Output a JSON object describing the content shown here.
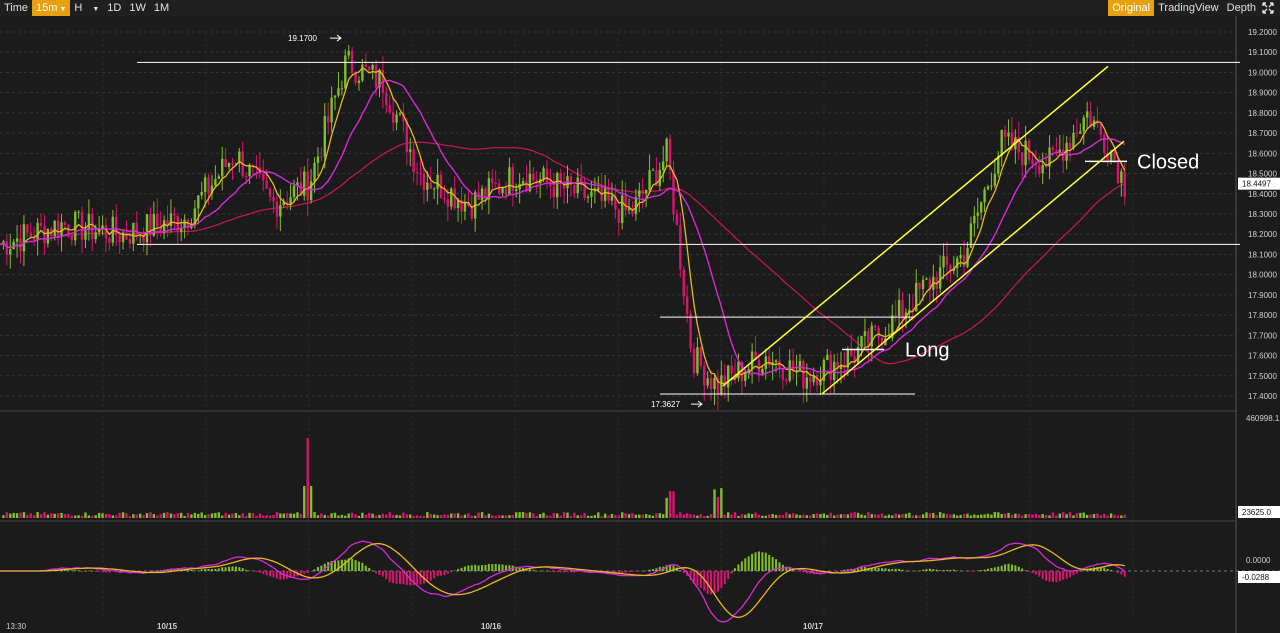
{
  "toolbar": {
    "time_label": "Time",
    "interval_active": "15m",
    "interval_h": "H",
    "interval_1d": "1D",
    "interval_1w": "1W",
    "interval_1m": "1M",
    "view_original": "Original",
    "view_tradingview": "TradingView",
    "view_depth": "Depth",
    "fullscreen_icon": "fullscreen-icon",
    "accent_color": "#e8a013"
  },
  "chart_data": {
    "type": "candlestick",
    "price_ticks": [
      "19.2000",
      "19.1000",
      "19.0000",
      "18.9000",
      "18.8000",
      "18.7000",
      "18.6000",
      "18.5000",
      "18.4000",
      "18.3000",
      "18.2000",
      "18.1000",
      "18.0000",
      "17.9000",
      "17.8000",
      "17.7000",
      "17.6000",
      "17.5000",
      "17.4000"
    ],
    "ylim": [
      17.4,
      19.2
    ],
    "current_price": "18.4497",
    "high_label": "19.1700",
    "low_label": "17.3627",
    "volume_max_label": "460998.12",
    "volume_current_label": "23625.0",
    "macd_zero_label": "0.0000",
    "macd_current_label": "-0.0288",
    "time_start_label": "13:30",
    "date_labels": [
      "10/15",
      "10/16",
      "10/17"
    ],
    "annotations": {
      "long": "Long",
      "closed": "Closed"
    },
    "colors": {
      "up": "#7fbf2a",
      "down": "#d8146f",
      "ma_short": "#e8b820",
      "ma_mid": "#d829d8",
      "ma_long": "#c8175a",
      "channel": "#ffff33",
      "level": "#ffffff"
    },
    "key_prices": [
      {
        "x": 0.0,
        "close": 18.15
      },
      {
        "x": 0.05,
        "close": 18.25
      },
      {
        "x": 0.1,
        "close": 18.2
      },
      {
        "x": 0.15,
        "close": 18.28
      },
      {
        "x": 0.19,
        "close": 18.6
      },
      {
        "x": 0.22,
        "close": 18.35
      },
      {
        "x": 0.25,
        "close": 18.45
      },
      {
        "x": 0.28,
        "close": 19.05
      },
      {
        "x": 0.31,
        "close": 18.95
      },
      {
        "x": 0.34,
        "close": 18.5
      },
      {
        "x": 0.38,
        "close": 18.35
      },
      {
        "x": 0.42,
        "close": 18.5
      },
      {
        "x": 0.47,
        "close": 18.4
      },
      {
        "x": 0.51,
        "close": 18.3
      },
      {
        "x": 0.54,
        "close": 18.6
      },
      {
        "x": 0.56,
        "close": 17.6
      },
      {
        "x": 0.58,
        "close": 17.45
      },
      {
        "x": 0.62,
        "close": 17.6
      },
      {
        "x": 0.65,
        "close": 17.5
      },
      {
        "x": 0.69,
        "close": 17.6
      },
      {
        "x": 0.72,
        "close": 17.75
      },
      {
        "x": 0.75,
        "close": 17.95
      },
      {
        "x": 0.78,
        "close": 18.1
      },
      {
        "x": 0.81,
        "close": 18.65
      },
      {
        "x": 0.85,
        "close": 18.55
      },
      {
        "x": 0.88,
        "close": 18.8
      },
      {
        "x": 0.9,
        "close": 18.6
      },
      {
        "x": 0.91,
        "close": 18.45
      }
    ]
  }
}
